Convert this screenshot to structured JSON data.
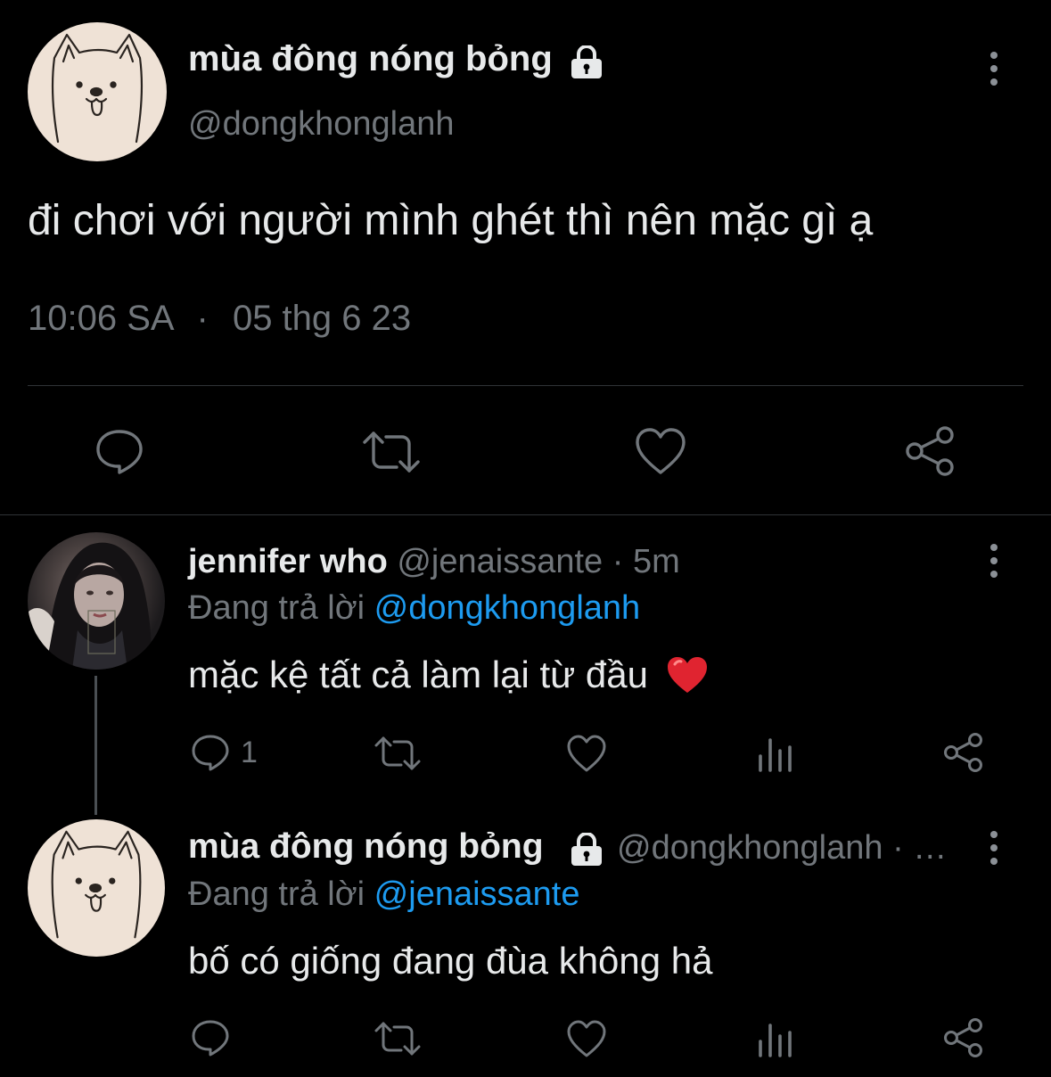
{
  "main_tweet": {
    "display_name": "mùa đông nóng bỏng",
    "handle": "@dongkhonglanh",
    "text": "đi chơi với người mình ghét thì nên mặc gì ạ",
    "time": "10:06 SA",
    "separator": "·",
    "date": "05 thg 6 23",
    "actions": [
      "reply-icon",
      "retweet-icon",
      "like-icon",
      "share-icon"
    ]
  },
  "replies": [
    {
      "display_name": "jennifer who",
      "handle": "@jenaissante",
      "dot": "·",
      "time": "5m",
      "replying_label": "Đang trả lời",
      "replying_to": "@dongkhonglanh",
      "text": "mặc kệ tất cả làm lại từ đầu",
      "emoji": "❤️",
      "reply_count": "1"
    },
    {
      "display_name": "mùa đông nóng bỏng",
      "handle": "@dongkhonglanh",
      "truncated": "· …",
      "replying_label": "Đang trả lời",
      "replying_to": "@jenaissante",
      "text": "bố có giống đang đùa không hả",
      "reply_count": ""
    }
  ],
  "colors": {
    "background": "#000000",
    "text": "#e7e9ea",
    "muted": "#71767b",
    "link": "#1d9bf0",
    "heart": "#e0245e"
  }
}
